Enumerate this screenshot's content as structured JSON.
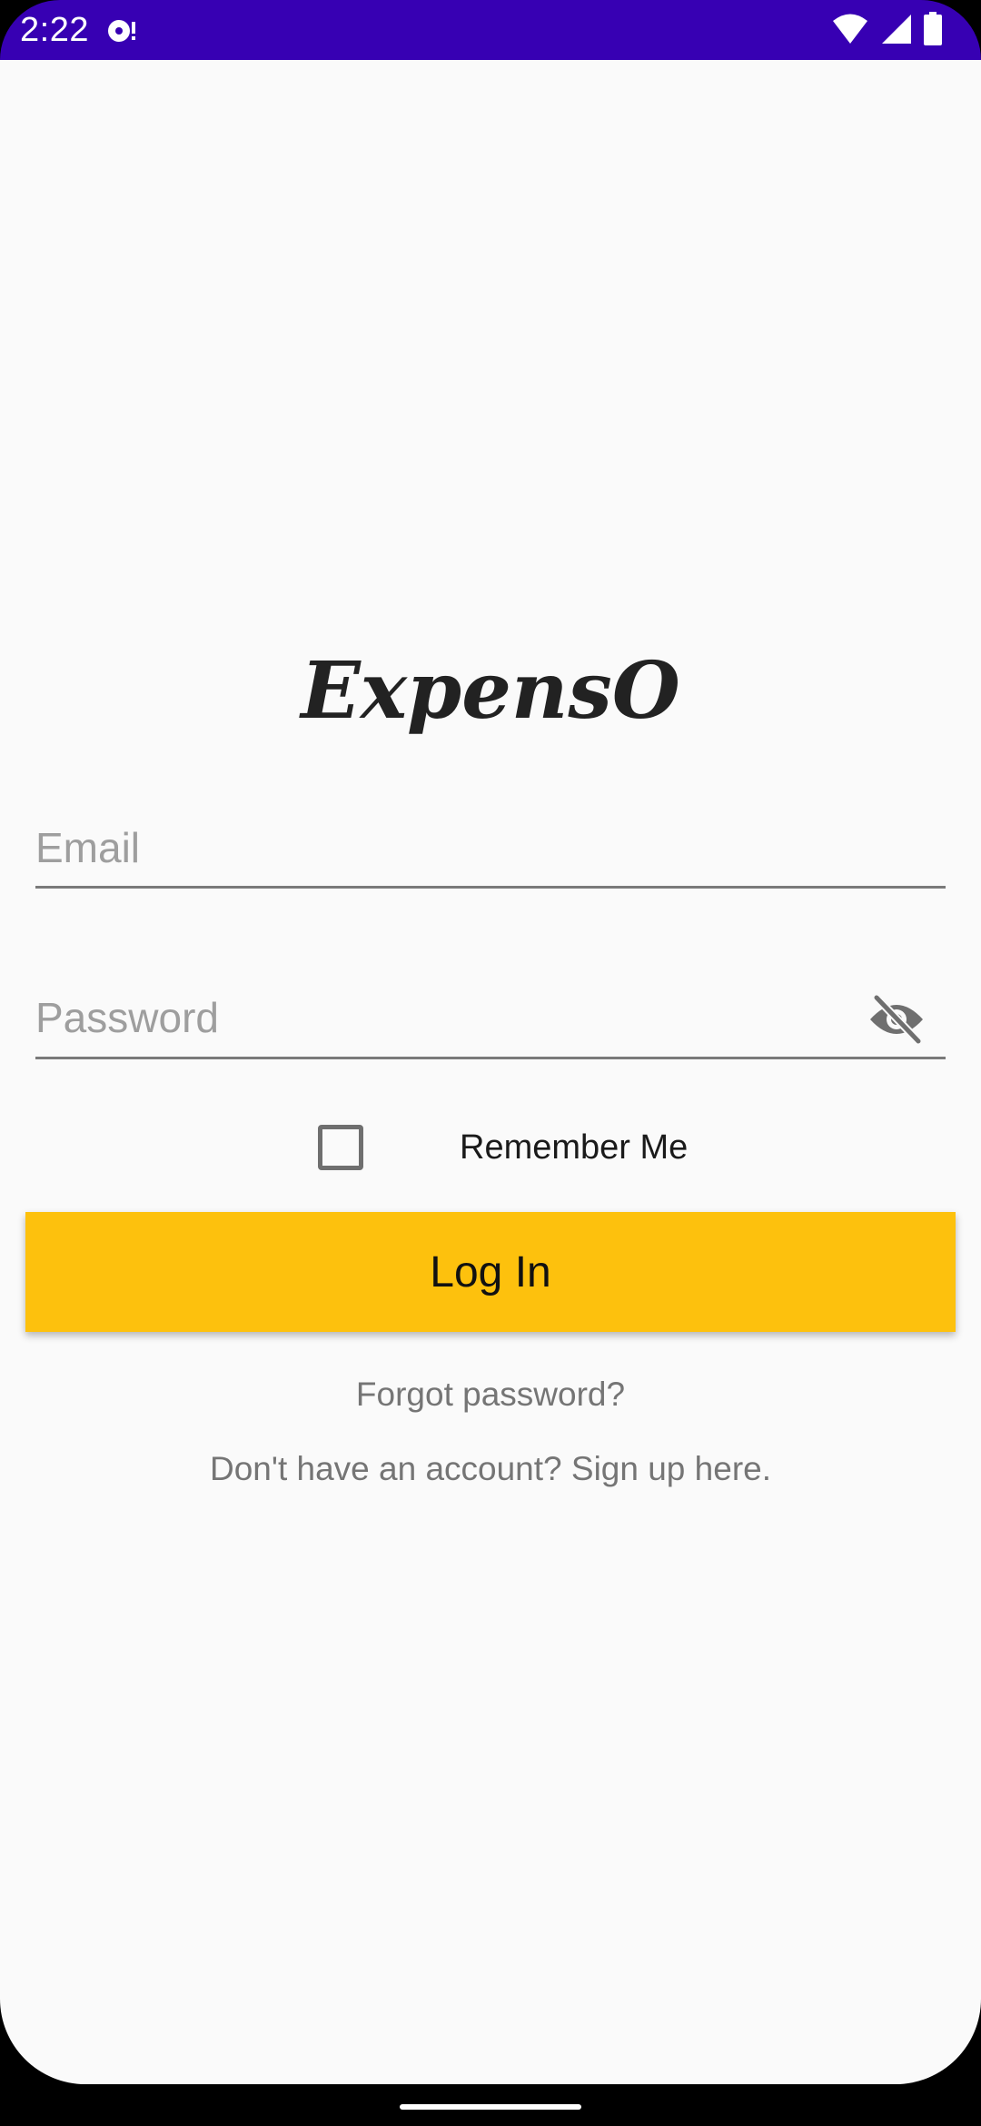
{
  "status_bar": {
    "time": "2:22",
    "background": "#3700b3",
    "left_icon": "media-notification-icon",
    "right_icons": [
      "wifi-icon",
      "cellular-signal-icon",
      "battery-icon"
    ]
  },
  "app": {
    "logo_text": "ExpensO",
    "background": "#fafafa"
  },
  "login_form": {
    "email": {
      "placeholder": "Email",
      "value": ""
    },
    "password": {
      "placeholder": "Password",
      "value": "",
      "visibility_icon": "visibility-off-icon"
    },
    "remember_me": {
      "label": "Remember Me",
      "checked": false
    },
    "login_button": {
      "label": "Log In",
      "color": "#fdc10d"
    },
    "forgot_password_link": "Forgot password?",
    "signup_link": "Don't have an account? Sign up here."
  }
}
